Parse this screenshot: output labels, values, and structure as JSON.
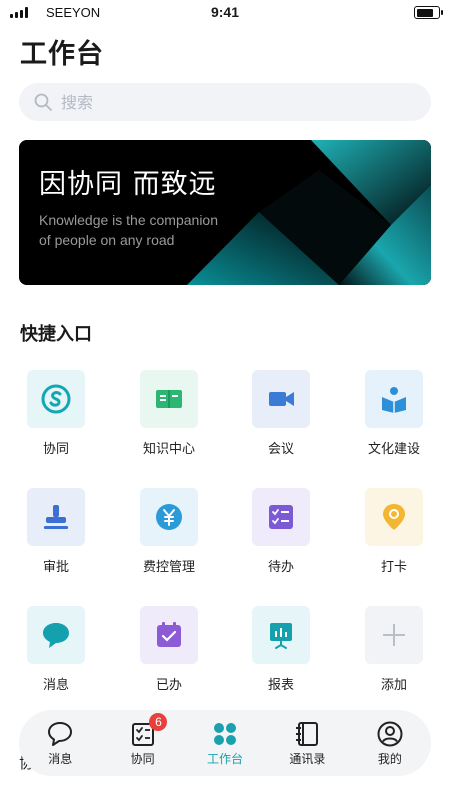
{
  "status": {
    "carrier": "SEEYON",
    "time": "9:41"
  },
  "page": {
    "title": "工作台"
  },
  "search": {
    "placeholder": "搜索"
  },
  "banner": {
    "title": "因协同 而致远",
    "subtitle": "Knowledge is the companion of people on any road"
  },
  "quick_access": {
    "title": "快捷入口",
    "items": [
      {
        "label": "协同",
        "icon": "s-logo-icon",
        "color": "#12a8b3"
      },
      {
        "label": "知识中心",
        "icon": "book-icon",
        "color": "#2bb673"
      },
      {
        "label": "会议",
        "icon": "video-camera-icon",
        "color": "#3a7bd5"
      },
      {
        "label": "文化建设",
        "icon": "reading-person-icon",
        "color": "#2d8fd8"
      },
      {
        "label": "审批",
        "icon": "stamp-icon",
        "color": "#3b6fd4"
      },
      {
        "label": "费控管理",
        "icon": "yuan-coin-icon",
        "color": "#2a9bd8"
      },
      {
        "label": "待办",
        "icon": "checklist-icon",
        "color": "#7c5ad6"
      },
      {
        "label": "打卡",
        "icon": "location-pin-icon",
        "color": "#f2b632"
      },
      {
        "label": "消息",
        "icon": "chat-bubble-icon",
        "color": "#14a0ad"
      },
      {
        "label": "已办",
        "icon": "calendar-check-icon",
        "color": "#8b5cd6"
      },
      {
        "label": "报表",
        "icon": "presentation-chart-icon",
        "color": "#14a0ad"
      },
      {
        "label": "添加",
        "icon": "plus-icon",
        "color": "#b9bec8"
      }
    ]
  },
  "tabbar": {
    "items": [
      {
        "label": "消息",
        "icon": "chat-bubble-outline-icon"
      },
      {
        "label": "协同",
        "icon": "checklist-outline-icon",
        "badge": "6"
      },
      {
        "label": "工作台",
        "icon": "grid-dots-icon",
        "active": true
      },
      {
        "label": "通讯录",
        "icon": "contacts-book-icon"
      },
      {
        "label": "我的",
        "icon": "user-circle-icon"
      }
    ]
  },
  "peek_text": "协"
}
